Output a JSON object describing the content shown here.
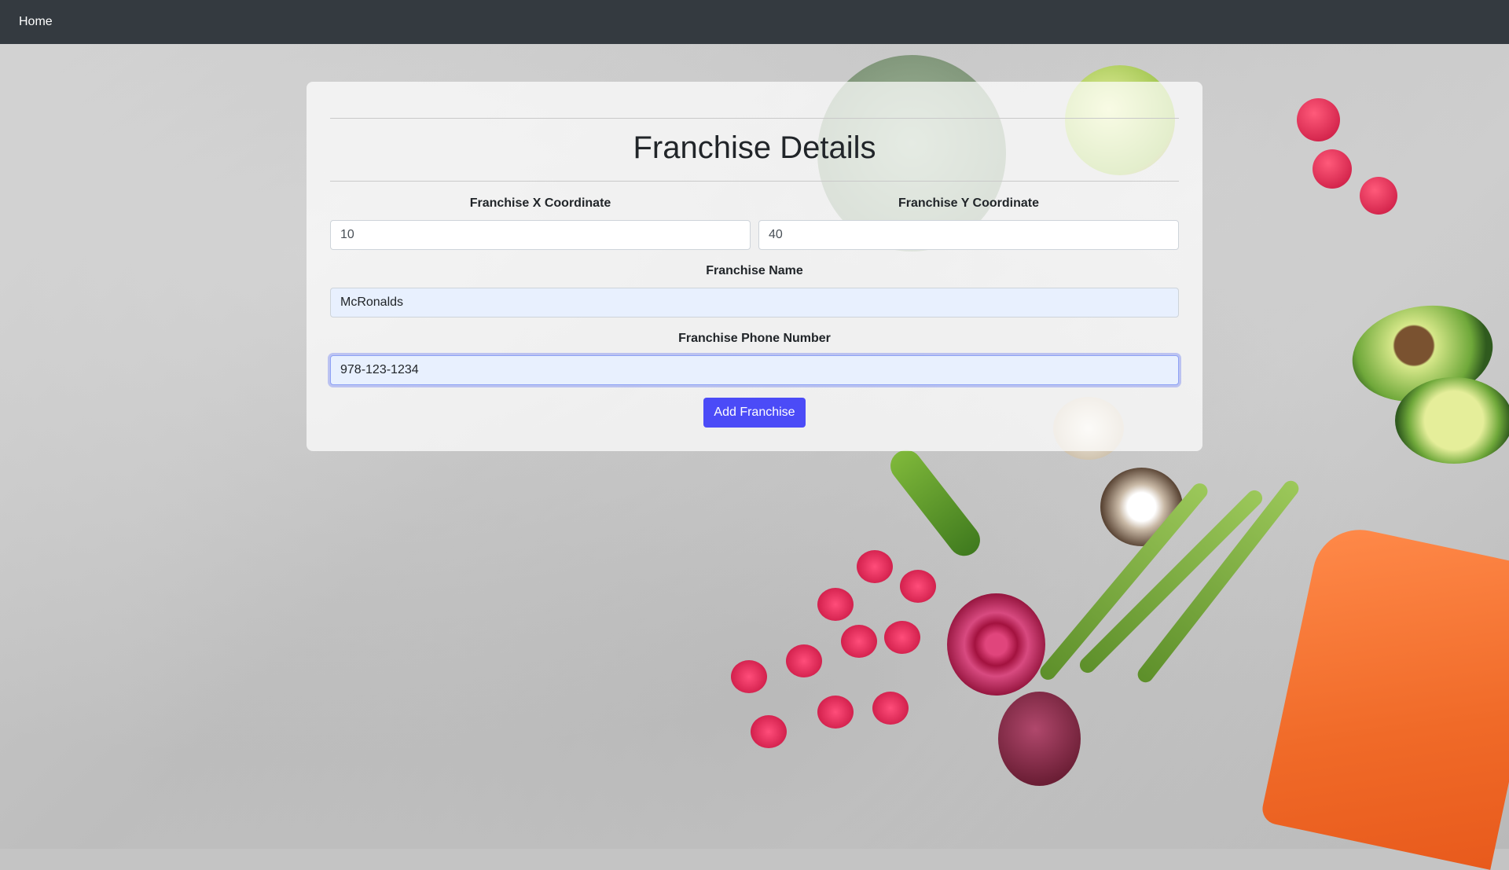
{
  "navbar": {
    "home_label": "Home"
  },
  "form": {
    "title": "Franchise Details",
    "x_coordinate": {
      "label": "Franchise X Coordinate",
      "value": "10"
    },
    "y_coordinate": {
      "label": "Franchise Y Coordinate",
      "value": "40"
    },
    "name": {
      "label": "Franchise Name",
      "value": "McRonalds"
    },
    "phone": {
      "label": "Franchise Phone Number",
      "value": "978-123-1234"
    },
    "submit_label": "Add Franchise"
  },
  "colors": {
    "navbar": "#343a40",
    "button": "#4b4bf7",
    "autofill": "#e8f0fe"
  }
}
